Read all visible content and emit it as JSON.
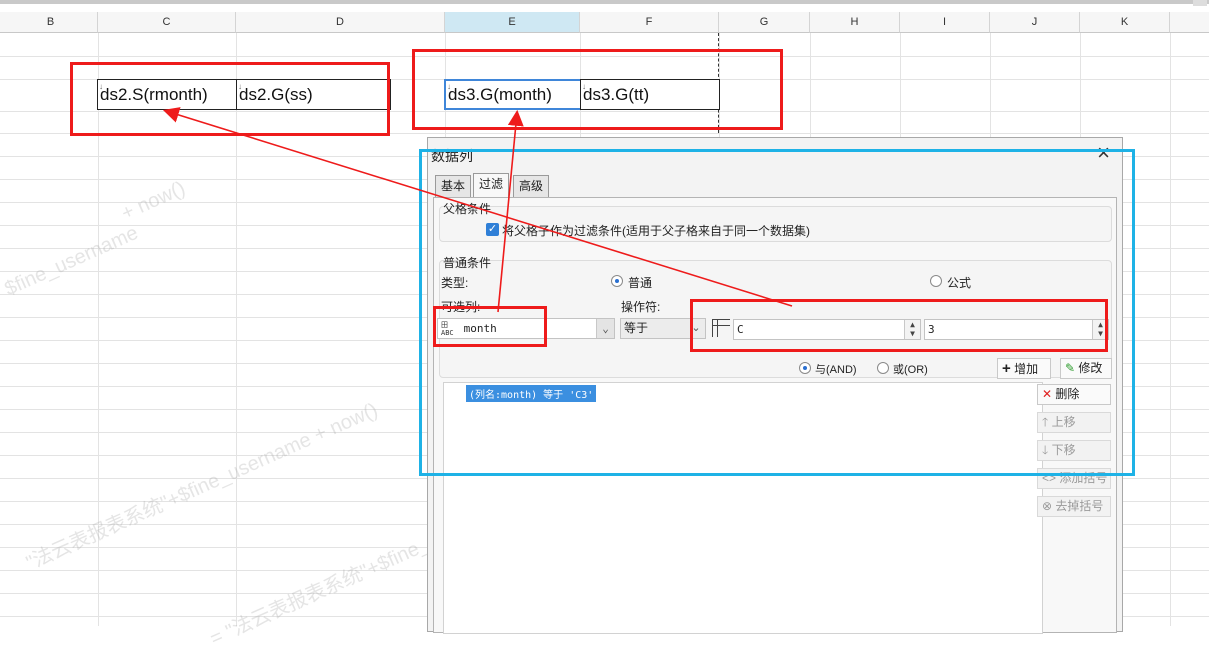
{
  "sheet": {
    "columns": [
      {
        "label": "B",
        "selected": false
      },
      {
        "label": "C",
        "selected": false
      },
      {
        "label": "D",
        "selected": false
      },
      {
        "label": "E",
        "selected": true
      },
      {
        "label": "F",
        "selected": false
      },
      {
        "label": "G",
        "selected": false
      },
      {
        "label": "H",
        "selected": false
      },
      {
        "label": "I",
        "selected": false
      },
      {
        "label": "J",
        "selected": false
      },
      {
        "label": "K",
        "selected": false
      }
    ],
    "cells": {
      "c3": "ds2.S(rmonth)",
      "d3": "ds2.G(ss)",
      "e3": "ds3.G(month)",
      "f3": "ds3.G(tt)"
    },
    "watermark_texts": [
      "+ now()",
      "$fine_username",
      "\"法云表报表系统\"+$fine_username + now()",
      "= \"法云表报表系统\"+$fine_"
    ]
  },
  "dialog": {
    "title": "数据列",
    "close_glyph": "×",
    "tabs": [
      {
        "label": "基本",
        "active": false
      },
      {
        "label": "过滤",
        "active": true
      },
      {
        "label": "高级",
        "active": false
      }
    ],
    "parent_condition": {
      "title": "父格条件",
      "checkbox_checked": true,
      "checkbox_label": "将父格子作为过滤条件(适用于父子格来自于同一个数据集)"
    },
    "normal_condition": {
      "title": "普通条件",
      "type_label": "类型:",
      "type_option_normal": "普通",
      "type_option_formula": "公式",
      "type_selected": "普通",
      "column_label": "可选列:",
      "column_value": "month",
      "operator_label": "操作符:",
      "operator_value": "等于",
      "value_column": "C",
      "value_row": "3",
      "logic_and": "与(AND)",
      "logic_or": "或(OR)",
      "logic_selected": "与(AND)",
      "add_button": "增加",
      "modify_button": "修改"
    },
    "condition_list": [
      "(列名:month) 等于 'C3'"
    ],
    "side_buttons": {
      "delete": "删除",
      "move_up": "上移",
      "move_down": "下移",
      "add_bracket": "添加括号",
      "remove_bracket": "去掉括号"
    }
  },
  "colors": {
    "annotation_red": "#ee1b1b",
    "annotation_blue": "#1eb2e6",
    "selection_blue": "#3f86d9",
    "list_highlight": "#3b8fe0"
  },
  "icons": [
    "dataset-column-icon",
    "cell-reference-icon",
    "plus-icon",
    "modify-icon",
    "delete-x-icon",
    "arrow-up-icon",
    "arrow-down-icon",
    "bracket-add-icon",
    "bracket-remove-icon",
    "close-icon"
  ]
}
